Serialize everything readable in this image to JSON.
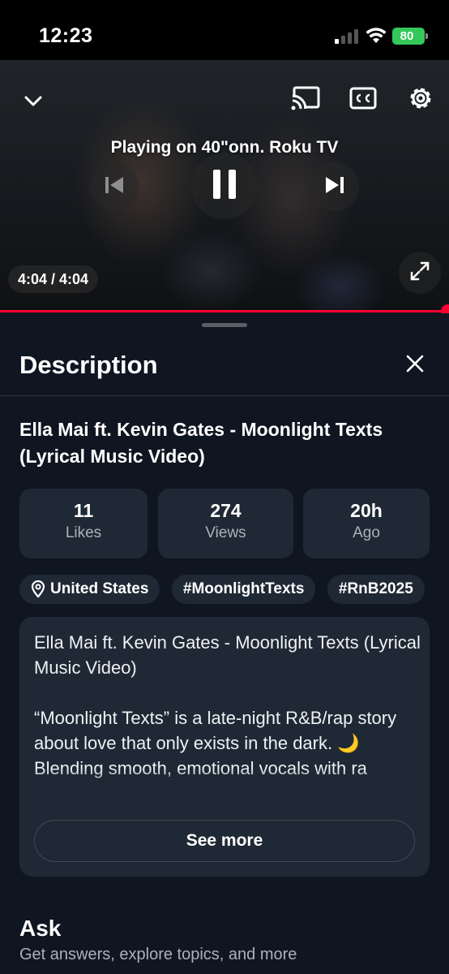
{
  "status_bar": {
    "time": "12:23",
    "battery": "80"
  },
  "player": {
    "playing_on": "Playing on 40\"onn. Roku TV",
    "time": "4:04 / 4:04",
    "progress": 1.0
  },
  "sheet": {
    "title": "Description",
    "video_title": "Ella Mai ft. Kevin Gates - Moonlight Texts (Lyrical Music Video)",
    "stats": [
      {
        "value": "11",
        "label": "Likes"
      },
      {
        "value": "274",
        "label": "Views"
      },
      {
        "value": "20h",
        "label": "Ago"
      }
    ],
    "chips": [
      "United States",
      "#MoonlightTexts",
      "#RnB2025"
    ],
    "description": {
      "line1": "Ella Mai ft. Kevin Gates - Moonlight Texts (Lyrical Music Video)",
      "line2": "“Moonlight Texts” is a late-night R&B/rap story about love that only exists in the dark. 🌙",
      "line3": "Blending smooth, emotional vocals with ra"
    },
    "see_more": "See more",
    "ask_title": "Ask",
    "ask_subtitle": "Get answers, explore topics, and more"
  },
  "colors": {
    "accent": "#ff0033",
    "card": "#1f2935",
    "background": "#0f1621",
    "battery": "#34c759"
  },
  "icons": [
    "chevron-down-icon",
    "cast-icon",
    "captions-icon",
    "settings-gear-icon",
    "previous-icon",
    "pause-icon",
    "next-icon",
    "fullscreen-icon",
    "close-icon",
    "location-pin-icon"
  ]
}
